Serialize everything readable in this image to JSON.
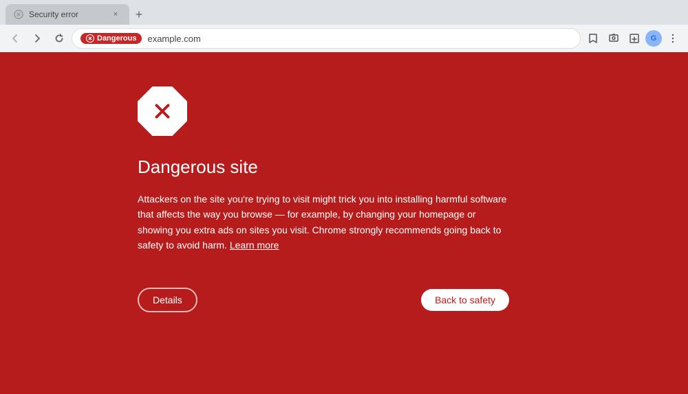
{
  "browser": {
    "tab": {
      "title": "Security error",
      "close_label": "×"
    },
    "toolbar": {
      "back_label": "◀",
      "forward_label": "▶",
      "reload_label": "↺",
      "dangerous_badge": "Dangerous",
      "url": "example.com",
      "bookmark_label": "☆",
      "new_tab_label": "+"
    }
  },
  "page": {
    "icon_alt": "Dangerous site warning icon",
    "title": "Dangerous site",
    "description": "Attackers on the site you're trying to visit might trick you into installing harmful software that affects the way you browse — for example, by changing your homepage or showing you extra ads on sites you visit. Chrome strongly recommends going back to safety to avoid harm.",
    "learn_more": "Learn more",
    "buttons": {
      "details": "Details",
      "back_to_safety": "Back to safety"
    }
  }
}
